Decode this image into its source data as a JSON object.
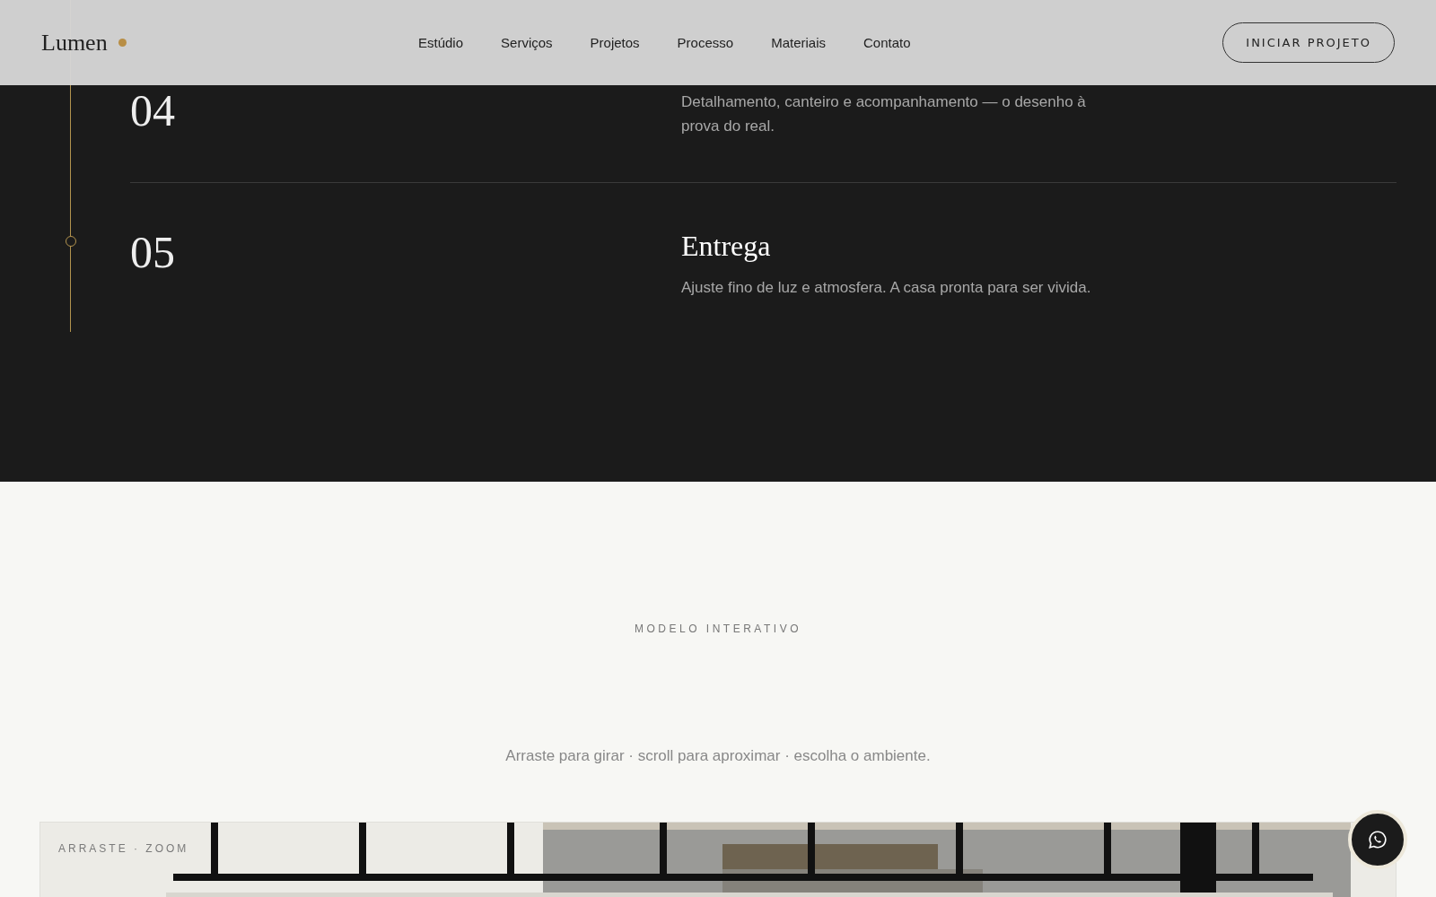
{
  "header": {
    "logo": "Lumen",
    "nav": [
      {
        "label": "Estúdio"
      },
      {
        "label": "Serviços"
      },
      {
        "label": "Projetos"
      },
      {
        "label": "Processo"
      },
      {
        "label": "Materiais"
      },
      {
        "label": "Contato"
      }
    ],
    "cta": "INICIAR PROJETO"
  },
  "process": {
    "steps": [
      {
        "number": "04",
        "description": "Detalhamento, canteiro e acompanhamento — o desenho à prova do real."
      },
      {
        "number": "05",
        "title": "Entrega",
        "description": "Ajuste fino de luz e atmosfera. A casa pronta para ser vivida."
      }
    ]
  },
  "model": {
    "eyebrow": "MODELO INTERATIVO",
    "subtitle": "Arraste para girar · scroll para aproximar · escolha o ambiente.",
    "hint": "ARRASTE · ZOOM"
  }
}
